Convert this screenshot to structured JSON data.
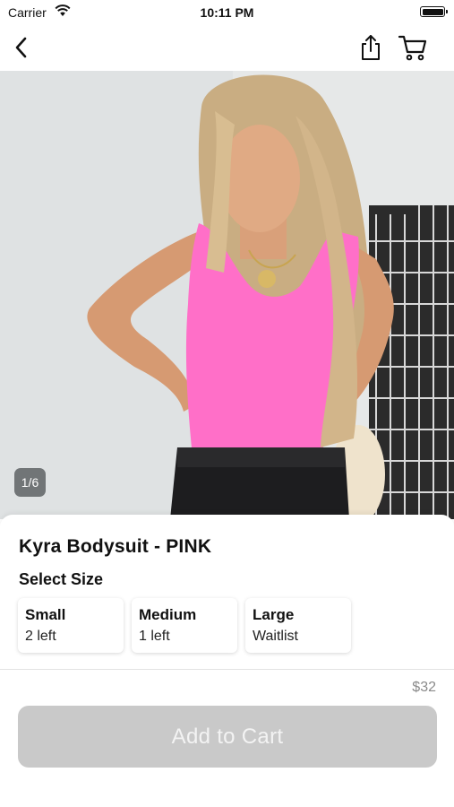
{
  "status_bar": {
    "carrier": "Carrier",
    "time": "10:11 PM"
  },
  "nav": {
    "back_icon": "chevron-left-icon",
    "share_icon": "share-icon",
    "cart_icon": "cart-icon"
  },
  "gallery": {
    "pager": "1/6"
  },
  "product": {
    "title": "Kyra Bodysuit - PINK",
    "size_heading": "Select Size",
    "sizes": [
      {
        "name": "Small",
        "stock": "2 left"
      },
      {
        "name": "Medium",
        "stock": "1 left"
      },
      {
        "name": "Large",
        "stock": "Waitlist"
      }
    ],
    "price": "$32",
    "add_to_cart": "Add to Cart"
  },
  "colors": {
    "accent_top": "#ff6fc8",
    "button_disabled": "#c9c9c9"
  }
}
